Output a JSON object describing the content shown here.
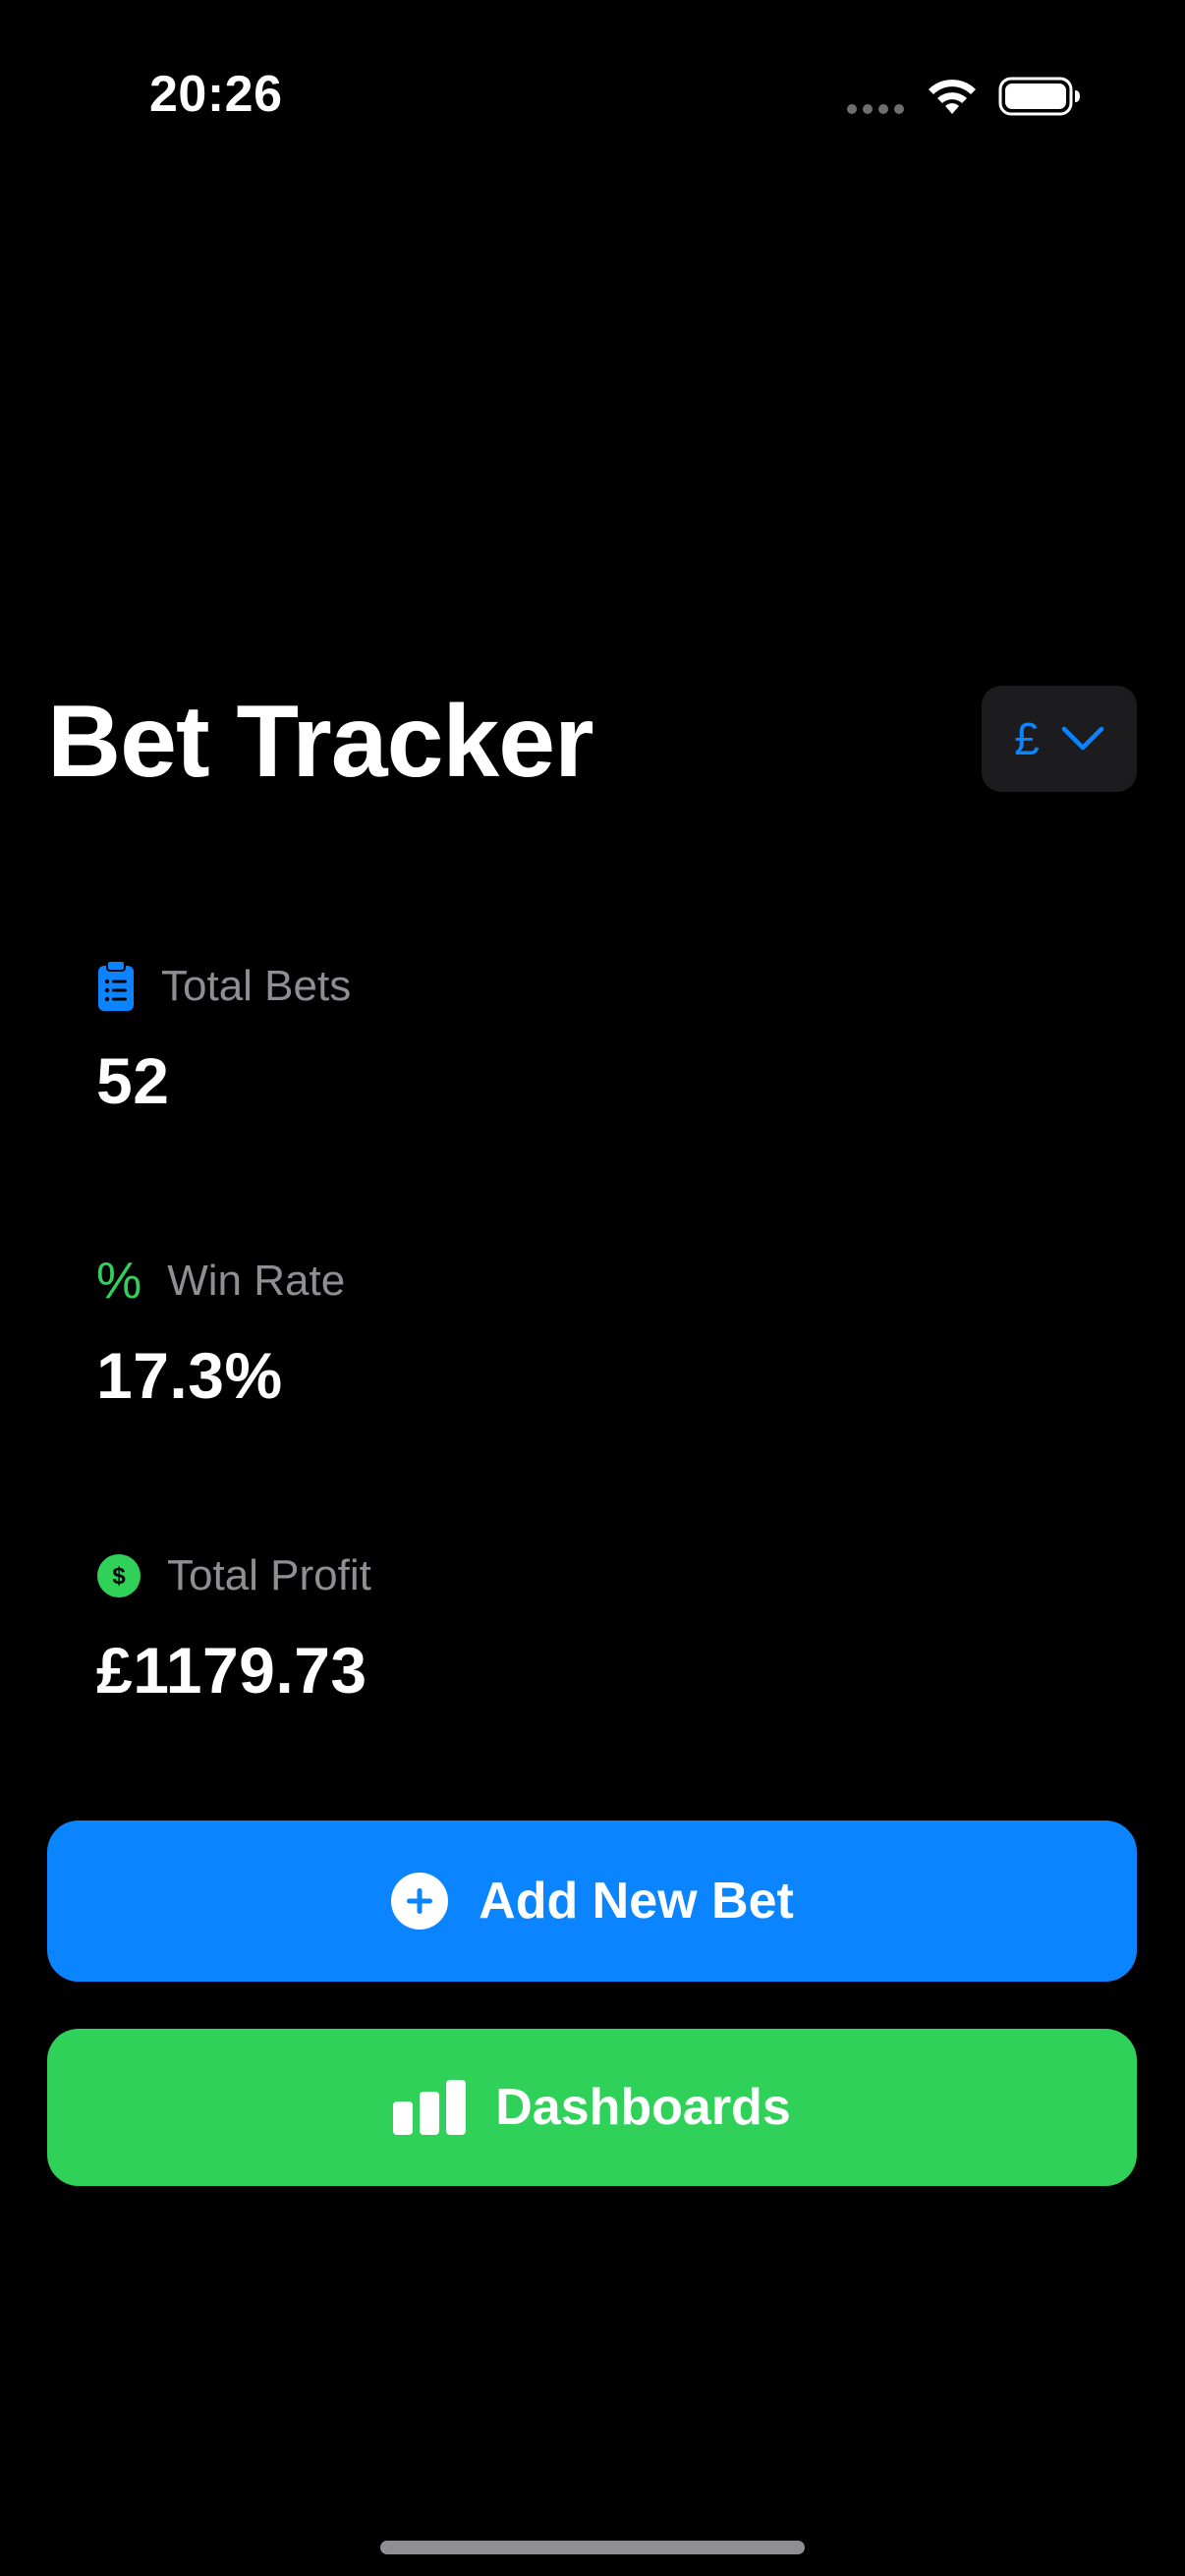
{
  "status_bar": {
    "time": "20:26",
    "icons": [
      "cellular-signal-icon",
      "wifi-icon",
      "battery-icon"
    ]
  },
  "header": {
    "title": "Bet Tracker",
    "currency": {
      "symbol": "£",
      "icon": "chevron-down-icon"
    }
  },
  "stats": {
    "total_bets": {
      "label": "Total Bets",
      "value": "52",
      "icon": "clipboard-list-icon"
    },
    "win_rate": {
      "label": "Win Rate",
      "value": "17.3%",
      "icon": "percent-icon",
      "icon_glyph": "%"
    },
    "total_profit": {
      "label": "Total Profit",
      "value": "£1179.73",
      "icon": "dollar-circle-icon"
    }
  },
  "actions": {
    "add_bet": {
      "label": "Add New Bet",
      "icon": "plus-circle-icon"
    },
    "dashboards": {
      "label": "Dashboards",
      "icon": "bar-chart-icon"
    }
  },
  "colors": {
    "background": "#000000",
    "accent_blue": "#0a84ff",
    "accent_green": "#30d158",
    "secondary_text": "#8e8e93",
    "picker_bg": "#1c1c1e"
  }
}
